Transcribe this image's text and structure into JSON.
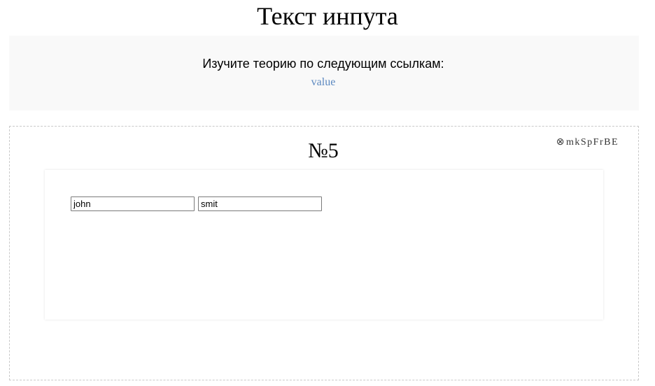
{
  "page": {
    "title": "Текст инпута"
  },
  "theory": {
    "intro": "Изучите теорию по следующим ссылкам:",
    "link_text": "value",
    "link_color": "#5b88c0"
  },
  "task": {
    "number": "№5",
    "id_icon": "circled-times-icon",
    "id_glyph": "⊗",
    "id_code": "mkSpFrBE"
  },
  "inputs": [
    {
      "value": "john"
    },
    {
      "value": "smit"
    }
  ]
}
